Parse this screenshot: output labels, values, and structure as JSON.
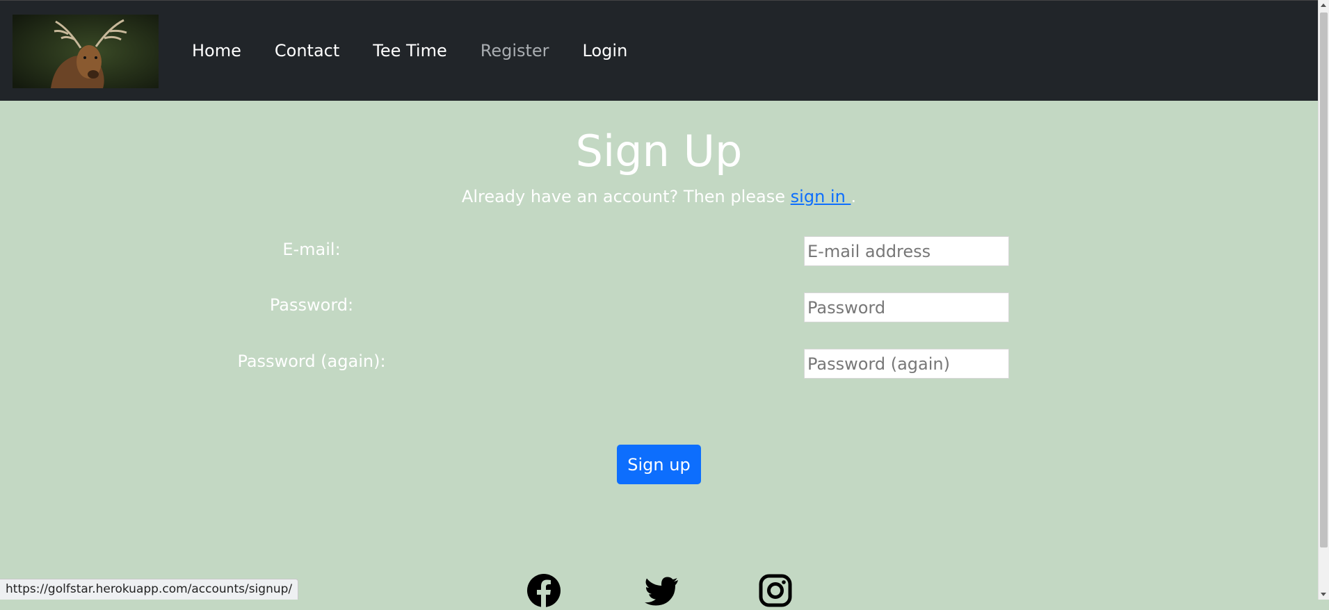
{
  "nav": {
    "logo_alt": "elk logo",
    "links": [
      "Home",
      "Contact",
      "Tee Time",
      "Register",
      "Login"
    ],
    "active_link": "Register"
  },
  "main": {
    "title": "Sign Up",
    "subtitle_text": "Already have an account? Then please ",
    "signin_link": "sign in ",
    "subtitle_end": "."
  },
  "form": {
    "email_label": "E-mail:",
    "email_placeholder": "E-mail address",
    "password_label": "Password:",
    "password_placeholder": "Password",
    "password2_label": "Password (again):",
    "password2_placeholder": "Password (again)",
    "submit_label": "Sign up"
  },
  "footer": {
    "icons": [
      "facebook-icon",
      "twitter-icon",
      "instagram-icon"
    ]
  },
  "status_bar": {
    "url": "https://golfstar.herokuapp.com/accounts/signup/"
  },
  "colors": {
    "navbar": "#212529",
    "page_background": "#c3d8c3",
    "primary": "#0d6efd"
  }
}
